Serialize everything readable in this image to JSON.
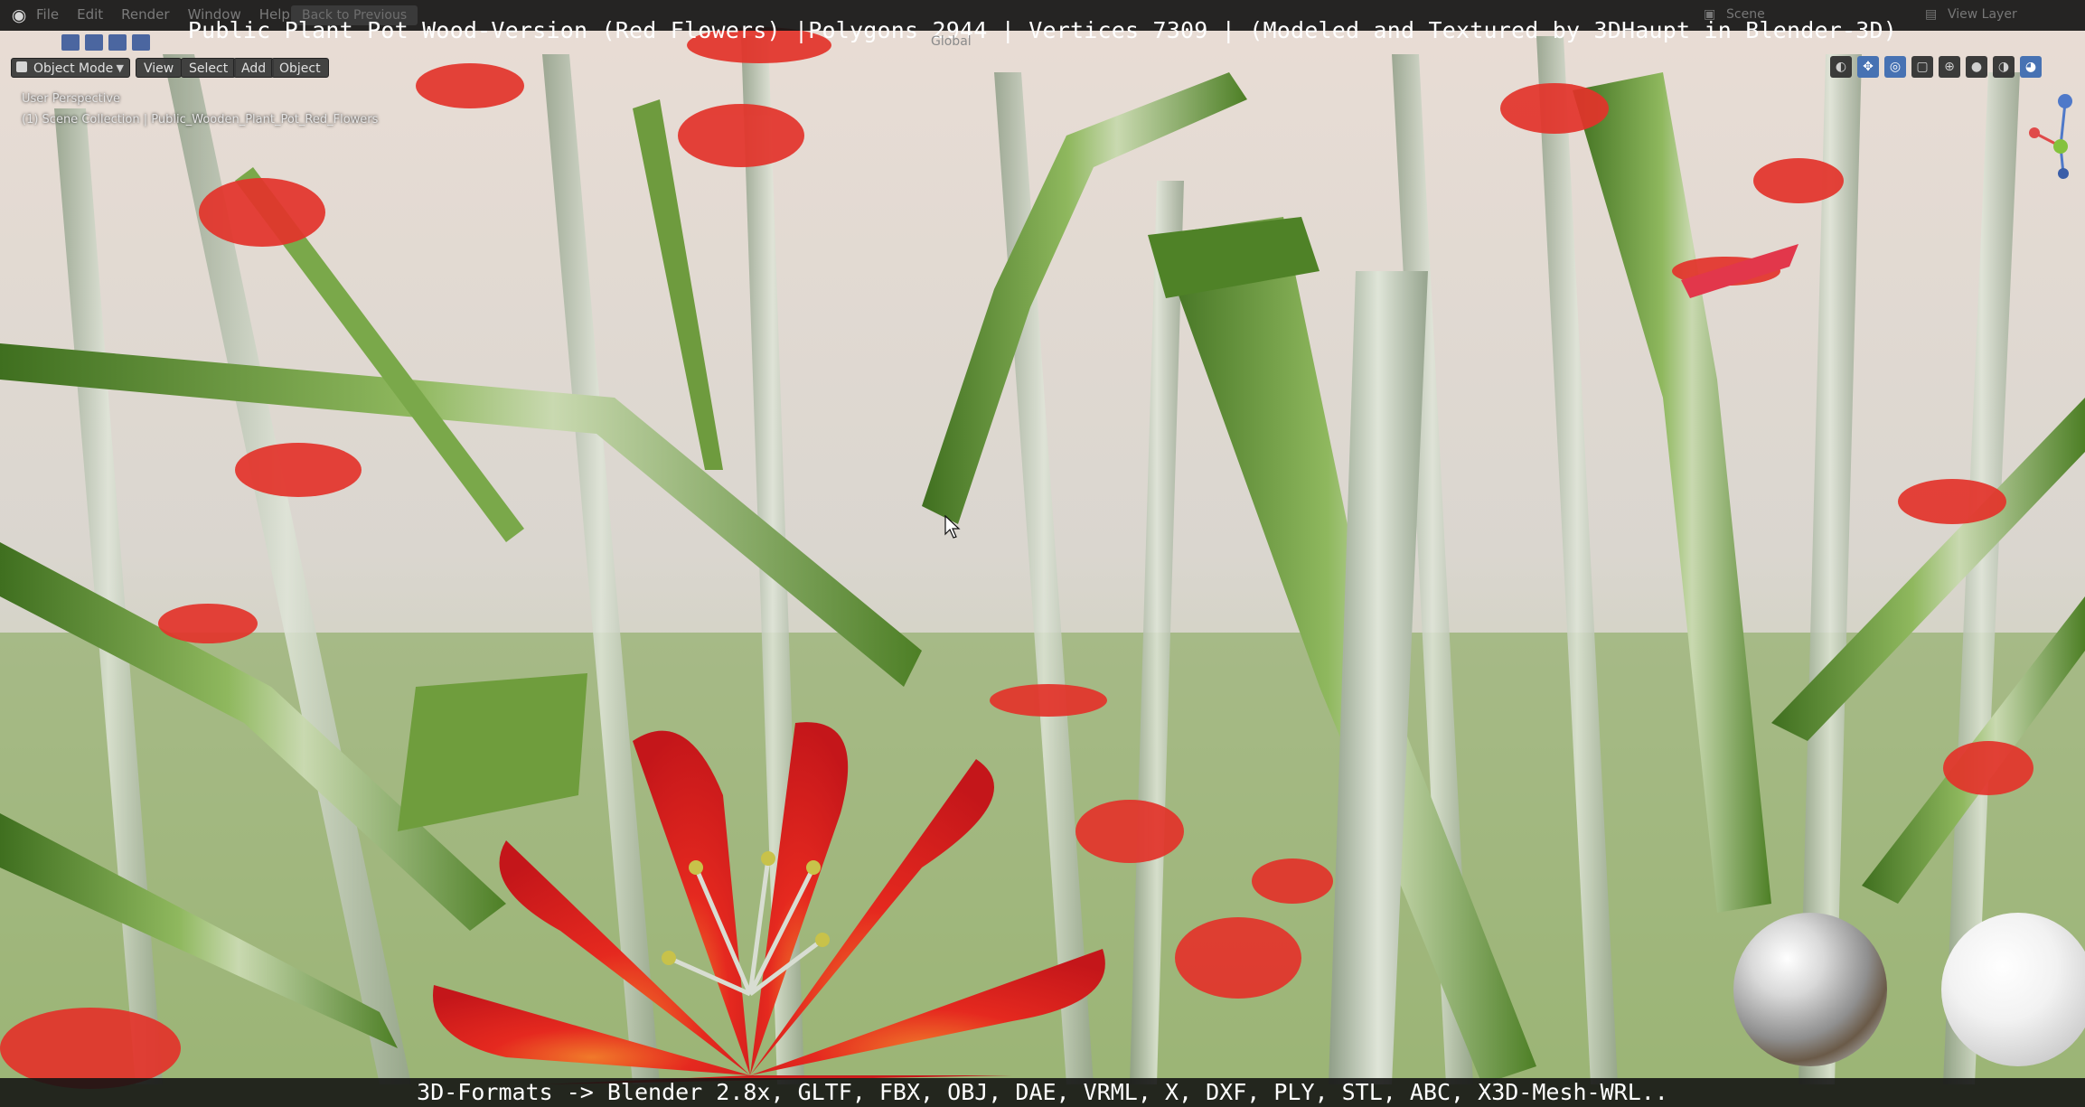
{
  "window": {
    "title": "Public Plant Pot Wood-Version (Red Flowers) |Polygons 2944 | Vertices 7309 | (Modeled and Textured by 3DHaupt in Blender-3D)",
    "menu": [
      "File",
      "Edit",
      "Render",
      "Window",
      "Help"
    ],
    "back_label": "Back to Previous",
    "scene_label": "Scene",
    "view_layer_label": "View Layer"
  },
  "viewport_header": {
    "mode_label": "Object Mode",
    "view_label": "View",
    "select_label": "Select",
    "add_label": "Add",
    "object_label": "Object",
    "orientation_label": "Global"
  },
  "viewport": {
    "perspective_label": "User Perspective",
    "collection_label": "(1) Scene Collection | Public_Wooden_Plant_Pot_Red_Flowers"
  },
  "caption": {
    "text": "3D-Formats -> Blender 2.8x, GLTF, FBX, OBJ, DAE, VRML, X, DXF, PLY, STL, ABC, X3D-Mesh-WRL.."
  },
  "colors": {
    "leaf_green": "#5e8f2e",
    "leaf_light": "#9dbf73",
    "stem_gray": "#b9c3b0",
    "flower_red": "#e12a1f",
    "sky": "#e8ddd6",
    "accent_blue": "#4772b3"
  },
  "icons": {
    "logo": "blender-logo-icon",
    "cursor": "mouse-pointer-icon",
    "gizmo": "axis-gizmo-icon"
  }
}
